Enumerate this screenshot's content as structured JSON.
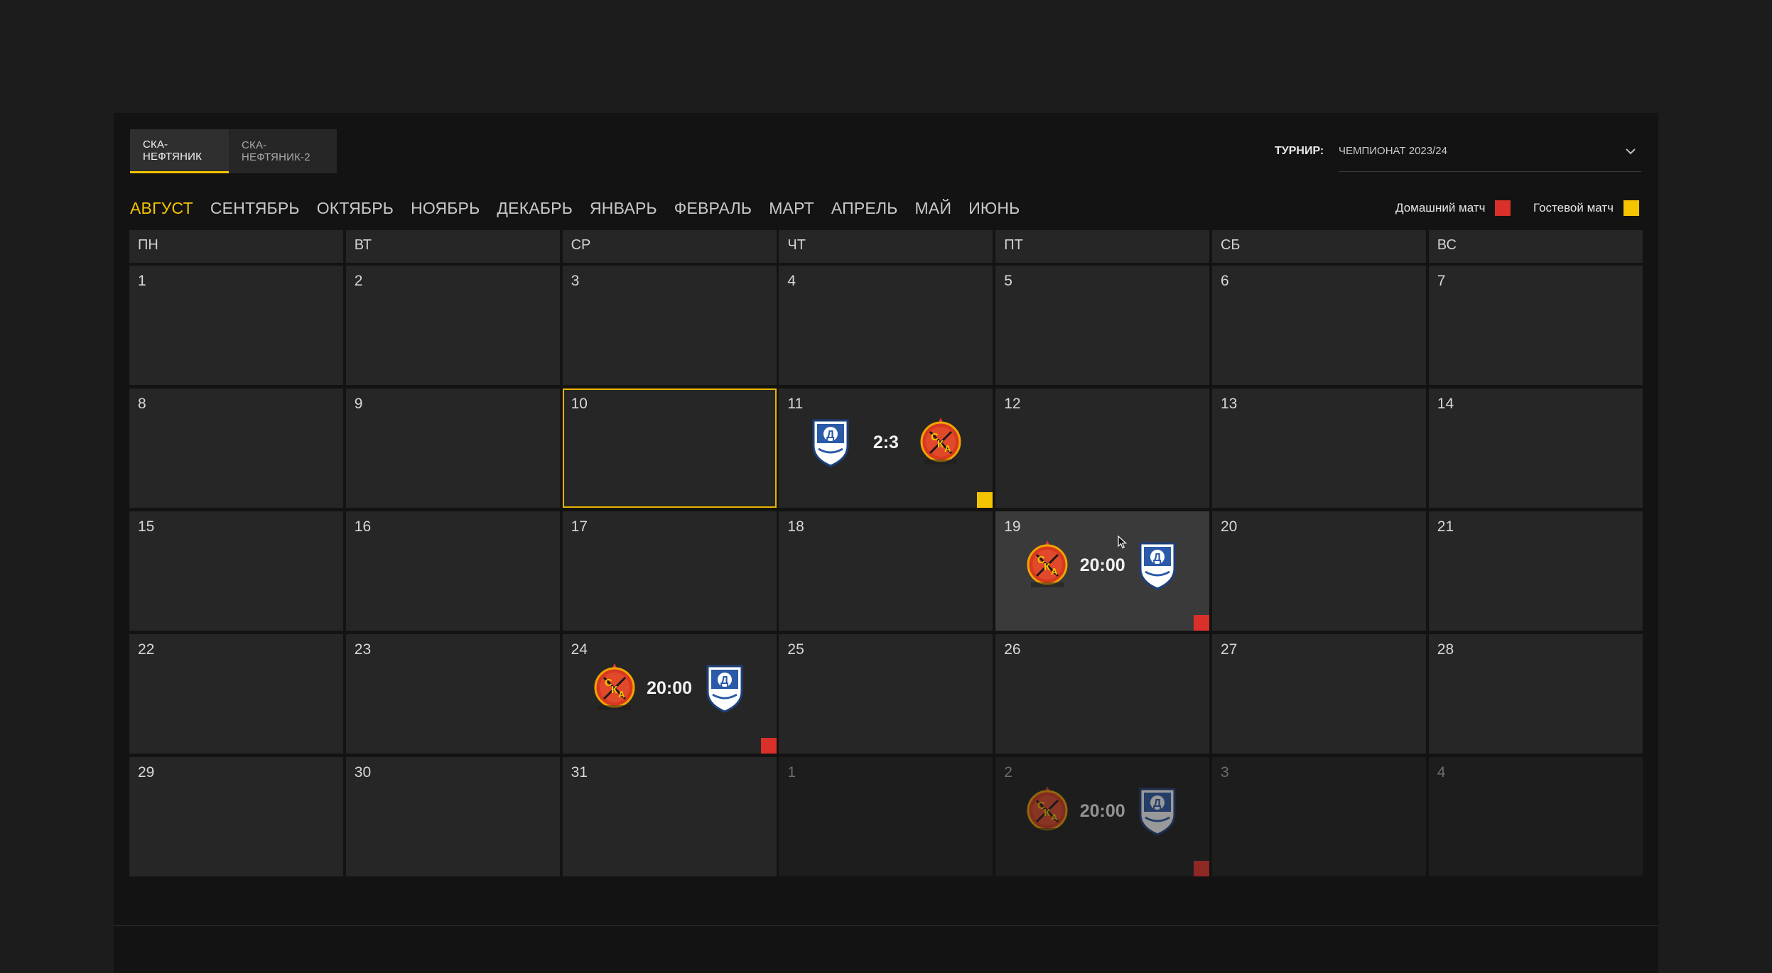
{
  "team_tabs": [
    {
      "label": "СКА-НЕФТЯНИК",
      "active": true
    },
    {
      "label": "СКА-НЕФТЯНИК-2",
      "active": false
    }
  ],
  "tournament": {
    "label": "ТУРНИР:",
    "value": "ЧЕМПИОНАТ 2023/24"
  },
  "months": [
    "АВГУСТ",
    "СЕНТЯБРЬ",
    "ОКТЯБРЬ",
    "НОЯБРЬ",
    "ДЕКАБРЬ",
    "ЯНВАРЬ",
    "ФЕВРАЛЬ",
    "МАРТ",
    "АПРЕЛЬ",
    "МАЙ",
    "ИЮНЬ"
  ],
  "active_month": "АВГУСТ",
  "legend": {
    "home_label": "Домашний матч",
    "home_color": "#d9302a",
    "away_label": "Гостевой матч",
    "away_color": "#f5c400"
  },
  "weekdays": [
    "ПН",
    "ВТ",
    "СР",
    "ЧТ",
    "ПТ",
    "СБ",
    "ВС"
  ],
  "days": [
    {
      "d": "1"
    },
    {
      "d": "2"
    },
    {
      "d": "3"
    },
    {
      "d": "4"
    },
    {
      "d": "5"
    },
    {
      "d": "6"
    },
    {
      "d": "7"
    },
    {
      "d": "8"
    },
    {
      "d": "9"
    },
    {
      "d": "10",
      "today": true
    },
    {
      "d": "11",
      "match": {
        "left": "dinamo-logo",
        "right": "ska-logo",
        "text": "2:3",
        "type": "away"
      }
    },
    {
      "d": "12"
    },
    {
      "d": "13"
    },
    {
      "d": "14"
    },
    {
      "d": "15"
    },
    {
      "d": "16"
    },
    {
      "d": "17"
    },
    {
      "d": "18"
    },
    {
      "d": "19",
      "hover": true,
      "match": {
        "left": "ska-logo",
        "right": "dinamo-logo",
        "text": "20:00",
        "type": "home"
      }
    },
    {
      "d": "20"
    },
    {
      "d": "21"
    },
    {
      "d": "22"
    },
    {
      "d": "23"
    },
    {
      "d": "24",
      "match": {
        "left": "ska-logo",
        "right": "dinamo-logo",
        "text": "20:00",
        "type": "home"
      }
    },
    {
      "d": "25"
    },
    {
      "d": "26"
    },
    {
      "d": "27"
    },
    {
      "d": "28"
    },
    {
      "d": "29"
    },
    {
      "d": "30"
    },
    {
      "d": "31"
    },
    {
      "d": "1",
      "other": true
    },
    {
      "d": "2",
      "other": true,
      "match": {
        "left": "ska-logo",
        "right": "dinamo-logo",
        "text": "20:00",
        "type": "home"
      }
    },
    {
      "d": "3",
      "other": true
    },
    {
      "d": "4",
      "other": true
    }
  ]
}
